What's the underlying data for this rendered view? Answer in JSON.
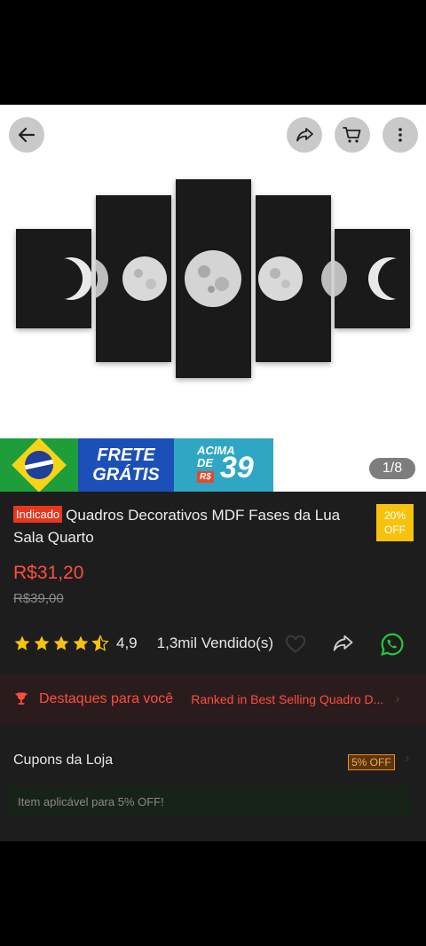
{
  "header": {
    "back_icon": "arrow-left-icon",
    "share_icon": "share-icon",
    "cart_icon": "cart-icon",
    "more_icon": "more-vertical-icon"
  },
  "banner": {
    "frete_line1": "FRETE",
    "frete_line2": "GRÁTIS",
    "acima_line1": "ACIMA",
    "acima_line2": "DE",
    "currency": "R$",
    "amount": "39"
  },
  "gallery": {
    "counter": "1/8"
  },
  "product": {
    "badge": "Indicado",
    "title": "Quadros Decorativos MDF Fases da Lua Sala Quarto",
    "discount_line1": "20%",
    "discount_line2": "OFF",
    "price": "R$31,20",
    "old_price": "R$39,00",
    "rating": "4,9",
    "rating_stars": 4.5,
    "sold": "1,3mil Vendido(s)"
  },
  "highlights": {
    "title": "Destaques para você",
    "rank": "Ranked in Best Selling Quadro D..."
  },
  "coupons": {
    "title": "Cupons da Loja",
    "tag": "5% OFF",
    "note": "Item aplicável para 5% OFF!"
  },
  "colors": {
    "accent": "#ff4d3d",
    "discount_badge": "#f7c20e",
    "whatsapp": "#25c43f"
  }
}
